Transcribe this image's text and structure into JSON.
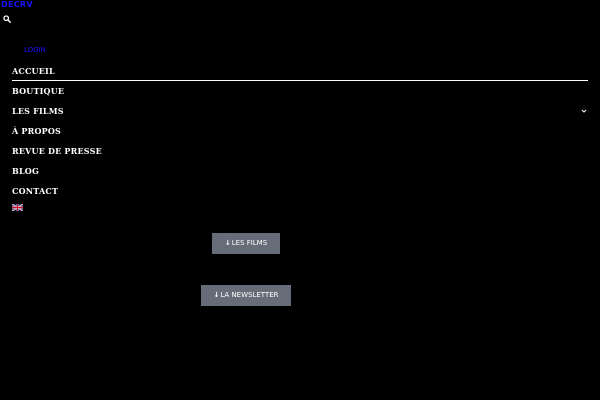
{
  "header": {
    "logo_text": "DECRV",
    "login_label": "LOGIN"
  },
  "nav": {
    "items": [
      {
        "label": "ACCUEIL",
        "active": true
      },
      {
        "label": "BOUTIQUE"
      },
      {
        "label": "LES FILMS",
        "has_submenu": true
      },
      {
        "label": "À PROPOS"
      },
      {
        "label": "REVUE DE PRESSE"
      },
      {
        "label": "BLOG"
      },
      {
        "label": "CONTACT"
      }
    ],
    "language_flag": "uk-flag-icon"
  },
  "buttons": {
    "films": {
      "arrow": "↓",
      "label": "LES FILMS"
    },
    "newsletter": {
      "arrow": "↓",
      "label": "LA NEWSLETTER"
    }
  },
  "colors": {
    "background": "#000000",
    "link": "#1a10ff",
    "button": "#676c79",
    "text": "#ffffff"
  }
}
